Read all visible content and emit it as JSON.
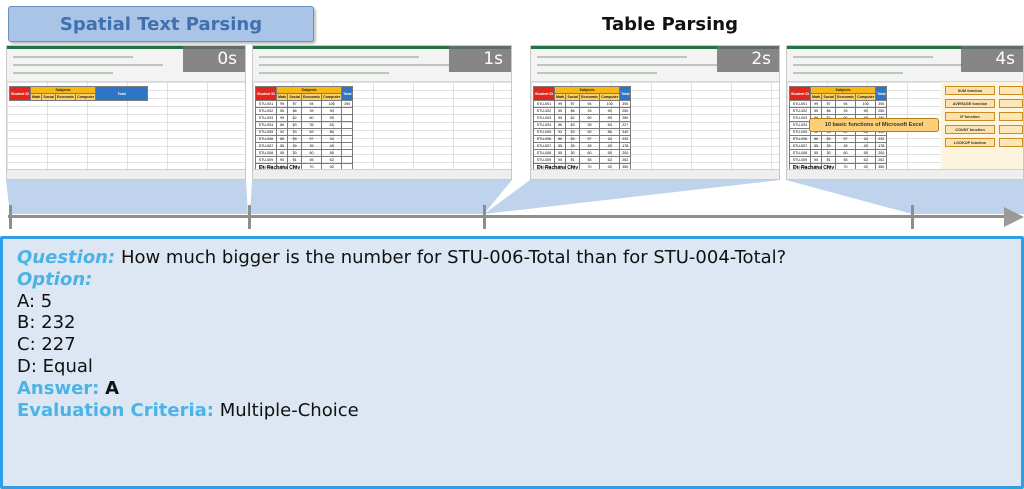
{
  "tags": {
    "spatial": "Spatial Text Parsing",
    "table": "Table Parsing"
  },
  "colors": {
    "tag_bg": "#a9c4e6",
    "panel_bg": "#dde7f4",
    "panel_border": "#2f9ee6",
    "label_color": "#4bb3e6",
    "timeline": "#8e8e8e"
  },
  "frames": [
    {
      "time": "0s"
    },
    {
      "time": "1s"
    },
    {
      "time": "2s"
    },
    {
      "time": "4s"
    }
  ],
  "spreadsheet": {
    "header": {
      "student_id": "Student ID",
      "subjects": "Subjects",
      "total": "Total"
    },
    "subjects": [
      "Math",
      "Social",
      "Economic",
      "Computer"
    ],
    "signoff": "Dr. Rachana Chiv",
    "rows": [
      {
        "id": "STU-001",
        "vals": [
          "99",
          "97",
          "94",
          "100"
        ],
        "total": "390"
      },
      {
        "id": "STU-002",
        "vals": [
          "55",
          "66",
          "39",
          "90"
        ],
        "total": "250"
      },
      {
        "id": "STU-003",
        "vals": [
          "99",
          "62",
          "60",
          "59"
        ],
        "total": "280"
      },
      {
        "id": "STU-004",
        "vals": [
          "66",
          "63",
          "35",
          "63"
        ],
        "total": "227"
      },
      {
        "id": "STU-005",
        "vals": [
          "92",
          "93",
          "69",
          "86"
        ],
        "total": "340"
      },
      {
        "id": "STU-006",
        "vals": [
          "86",
          "55",
          "57",
          "34"
        ],
        "total": "232"
      },
      {
        "id": "STU-007",
        "vals": [
          "55",
          "39",
          "39",
          "45"
        ],
        "total": "178"
      },
      {
        "id": "STU-008",
        "vals": [
          "55",
          "30",
          "60",
          "55"
        ],
        "total": "200"
      },
      {
        "id": "STU-009",
        "vals": [
          "90",
          "91",
          "55",
          "62"
        ],
        "total": "262"
      },
      {
        "id": "STU-010",
        "vals": [
          "99",
          "89",
          "70",
          "92"
        ],
        "total": "350"
      }
    ]
  },
  "functions_panel": {
    "banner": "10 basic functions of Microsoft Excel",
    "buttons": [
      "SUM function",
      "AVERAGE function",
      "IF function",
      "COUNT function",
      "LOOKUP function"
    ]
  },
  "qa": {
    "question_label": "Question:",
    "question_text": "How much bigger is the number for STU-006-Total than for STU-004-Total?",
    "option_label": "Option:",
    "options": [
      "A: 5",
      "B: 232",
      "C: 227",
      "D: Equal"
    ],
    "answer_label": "Answer:",
    "answer_value": "A",
    "criteria_label": "Evaluation Criteria:",
    "criteria_value": "Multiple-Choice"
  }
}
